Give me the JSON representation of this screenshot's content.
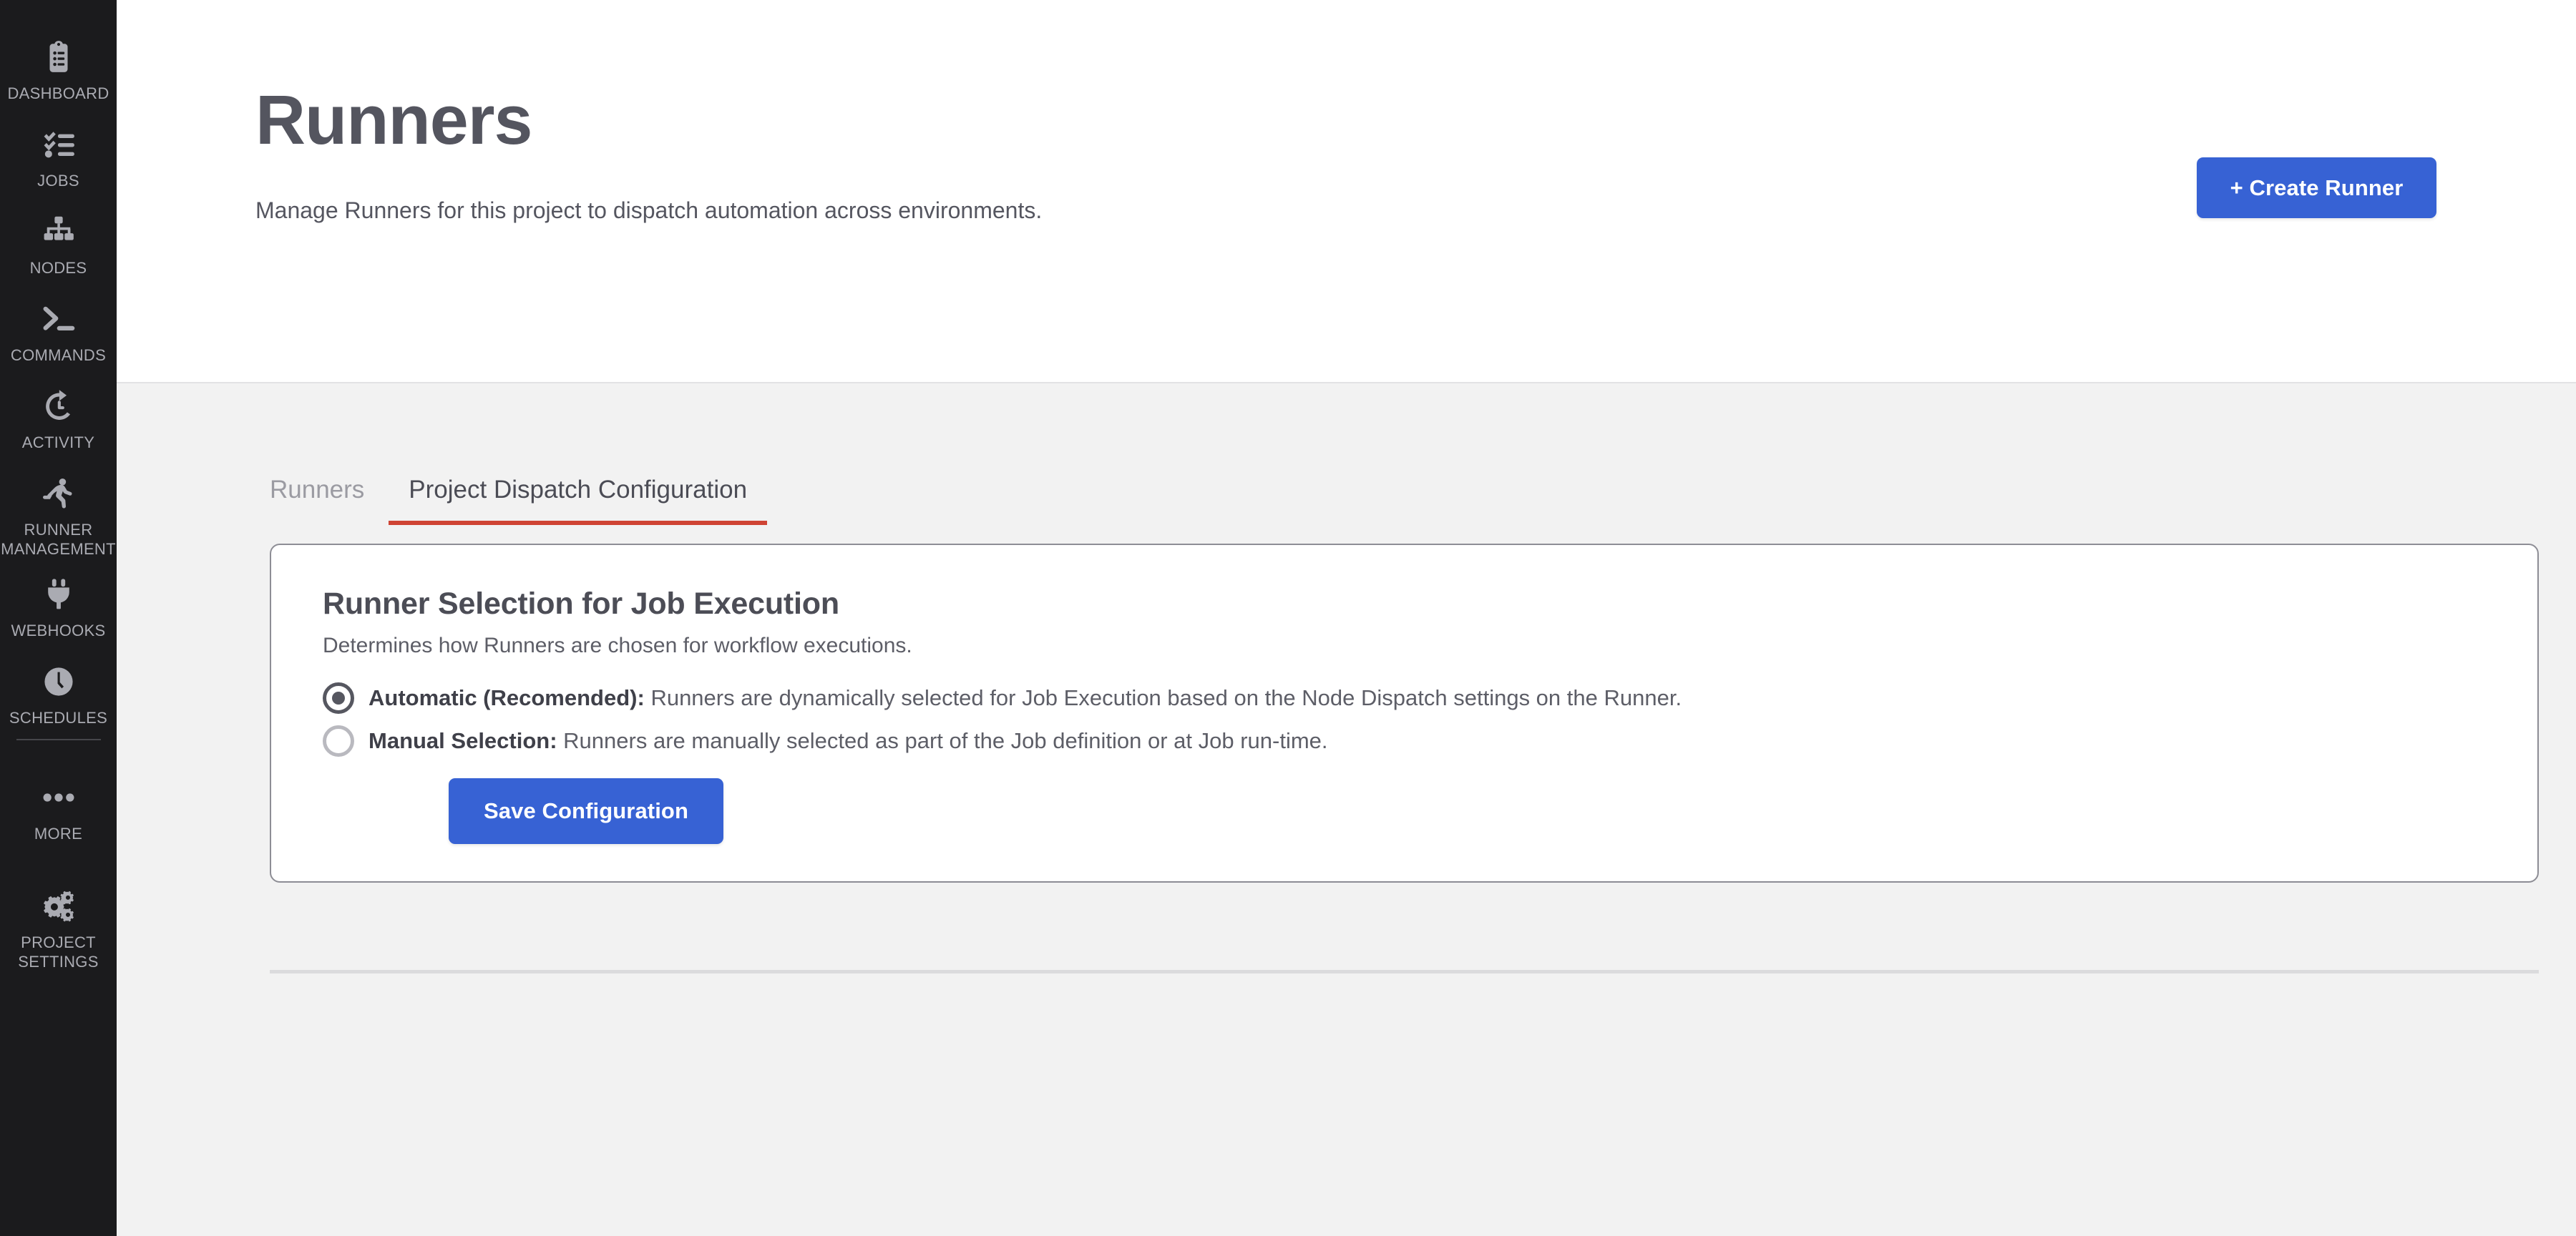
{
  "sidebar": {
    "items": [
      {
        "id": "dashboard",
        "icon": "clipboard-list-icon",
        "label": "DASHBOARD"
      },
      {
        "id": "jobs",
        "icon": "checklist-icon",
        "label": "JOBS"
      },
      {
        "id": "nodes",
        "icon": "sitemap-icon",
        "label": "NODES"
      },
      {
        "id": "commands",
        "icon": "terminal-icon",
        "label": "COMMANDS"
      },
      {
        "id": "activity",
        "icon": "history-clock-icon",
        "label": "ACTIVITY"
      },
      {
        "id": "runner-management",
        "icon": "running-person-icon",
        "label": "RUNNER MANAGEMENT"
      },
      {
        "id": "webhooks",
        "icon": "plug-icon",
        "label": "WEBHOOKS"
      },
      {
        "id": "schedules",
        "icon": "clock-icon",
        "label": "SCHEDULES"
      },
      {
        "id": "more",
        "icon": "ellipsis-icon",
        "label": "MORE"
      },
      {
        "id": "project-settings",
        "icon": "gears-icon",
        "label": "PROJECT SETTINGS"
      }
    ]
  },
  "header": {
    "title": "Runners",
    "subtitle": "Manage Runners for this project to dispatch automation across environments.",
    "create_button": "+ Create Runner"
  },
  "tabs": [
    {
      "id": "runners",
      "label": "Runners",
      "active": false
    },
    {
      "id": "project-dispatch-configuration",
      "label": "Project Dispatch Configuration",
      "active": true
    }
  ],
  "card": {
    "title": "Runner Selection for Job Execution",
    "subtitle": "Determines how Runners are chosen for workflow executions.",
    "options": [
      {
        "id": "automatic",
        "label": "Automatic (Recomended):",
        "description": "Runners are dynamically selected for Job Execution based on the Node Dispatch settings on the Runner.",
        "selected": true
      },
      {
        "id": "manual",
        "label": "Manual Selection:",
        "description": "Runners are manually selected as part of the Job definition or at Job run-time.",
        "selected": false
      }
    ],
    "save_button": "Save Configuration"
  },
  "colors": {
    "primary_blue": "#3762d4",
    "active_tab_underline": "#cf4434",
    "sidebar_bg": "#1b1b1d",
    "sidebar_icon": "#aaabb2",
    "content_bg": "#f2f2f2",
    "heading_text": "#54555f"
  }
}
